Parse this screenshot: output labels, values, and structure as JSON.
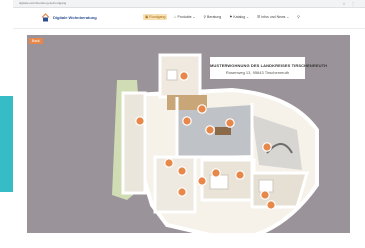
{
  "browser": {
    "url": "digitale-wohnberatung.de/rundgang"
  },
  "brand": {
    "name": "Digitale Wohnberatung"
  },
  "menu": [
    {
      "label": "▣ Rundgang",
      "active": true
    },
    {
      "label": "☆ Produkte ⌄",
      "active": false
    },
    {
      "label": "⚲ Beratung",
      "active": false
    },
    {
      "label": "⚑ Katalog ⌄",
      "active": false
    },
    {
      "label": "☰ Infos und News ⌄",
      "active": false
    },
    {
      "label": "⚲",
      "active": false
    }
  ],
  "stage": {
    "back_label": "Back",
    "title": "MUSTERWOHNUNG DES LANDKREISES TIRSCHENREUTH",
    "address": "Rosenweg 13, 95643 Tirschenreuth"
  },
  "hotspots": 15,
  "colors": {
    "accent": "#e8874a",
    "side_bar": "#35bcc6",
    "stage_bg": "#9a9399",
    "brand": "#2c4f8f"
  }
}
